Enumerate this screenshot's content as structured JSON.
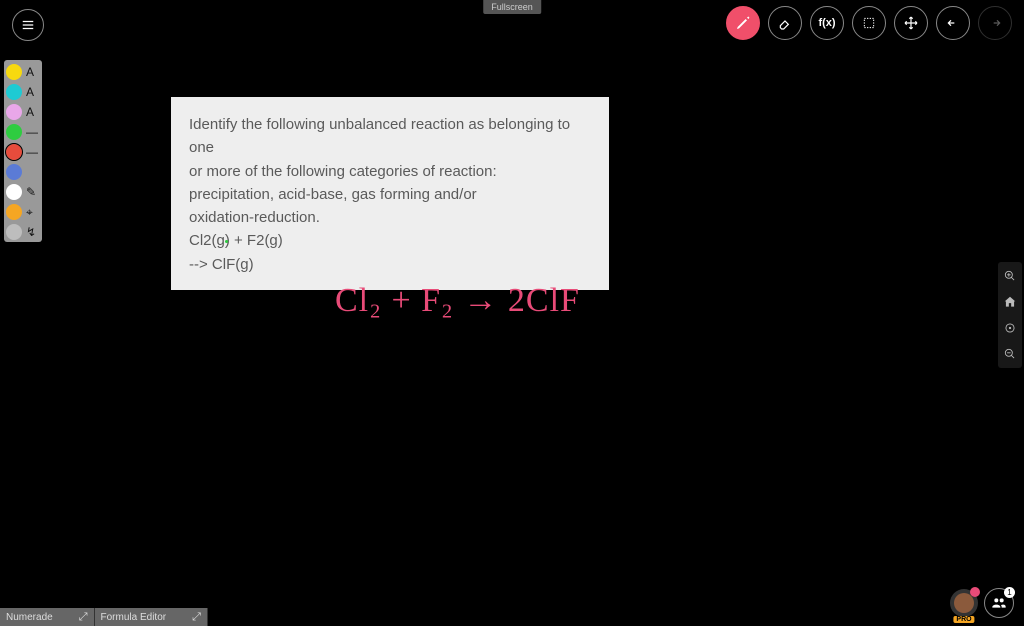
{
  "top": {
    "center_tag": "Fullscreen",
    "tools": [
      {
        "name": "pencil",
        "active": true
      },
      {
        "name": "eraser",
        "active": false
      },
      {
        "name": "fx",
        "label": "f(x)",
        "active": false
      },
      {
        "name": "select",
        "active": false
      },
      {
        "name": "move",
        "active": false
      },
      {
        "name": "undo",
        "active": false
      },
      {
        "name": "redo",
        "active": false,
        "disabled": true
      }
    ]
  },
  "palette": [
    {
      "color": "#f7d90f",
      "label": "A"
    },
    {
      "color": "#1ecad3",
      "label": "A"
    },
    {
      "color": "#e9a7e9",
      "label": "A"
    },
    {
      "color": "#2ecc40",
      "label": "—"
    },
    {
      "color": "#e74c3c",
      "label": "—",
      "selected": true
    },
    {
      "color": "#5b7bd6",
      "label": ""
    },
    {
      "color": "#ffffff",
      "label": "✎"
    },
    {
      "color": "#f5a623",
      "label": "⌖"
    },
    {
      "color": "#bdbdbd",
      "label": "↯"
    }
  ],
  "question": {
    "line1": "Identify the following unbalanced reaction as belonging to one",
    "line2": "or more of the following categories of reaction:",
    "line3": "precipitation, acid-base, gas forming and/or",
    "line4": "oxidation-reduction.",
    "line5": "Cl2(g) + F2(g)",
    "line6": "--> ClF(g)"
  },
  "handwriting": "Cl₂ + F₂ → 2ClF",
  "side_tools": [
    "zoom-in",
    "home",
    "target",
    "zoom-out"
  ],
  "bottom_tabs": [
    {
      "label": "Numerade"
    },
    {
      "label": "Formula Editor"
    }
  ],
  "collab": {
    "pro_label": "PRO",
    "group_count": "1"
  }
}
